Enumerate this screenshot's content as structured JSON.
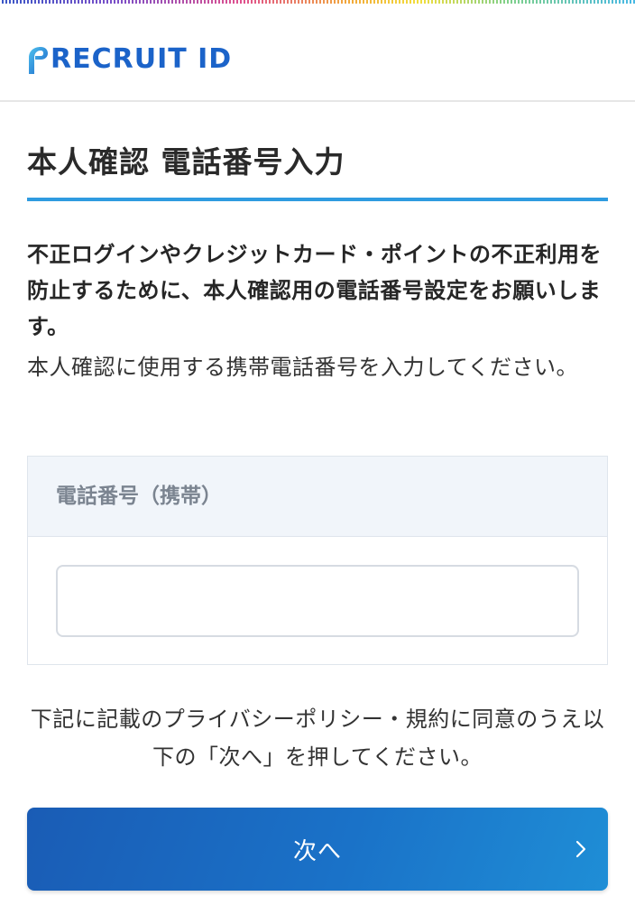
{
  "header": {
    "logo_text": "RECRUIT ID",
    "brand_color": "#1b63c9"
  },
  "main": {
    "title": "本人確認 電話番号入力",
    "description_bold": "不正ログインやクレジットカード・ポイントの不正利用を防止するために、本人確認用の電話番号設定をお願いします。",
    "description": "本人確認に使用する携帯電話番号を入力してください。",
    "phone_field": {
      "label": "電話番号（携帯）",
      "value": "",
      "placeholder": ""
    },
    "notice": "下記に記載のプライバシーポリシー・規約に同意のうえ以下の「次へ」を押してください。",
    "next_button": {
      "label": "次へ",
      "icon": "chevron-right-icon"
    }
  },
  "colors": {
    "accent": "#2f9be0",
    "button": "#1a6ac2",
    "field_header_bg": "#f1f5fa"
  }
}
